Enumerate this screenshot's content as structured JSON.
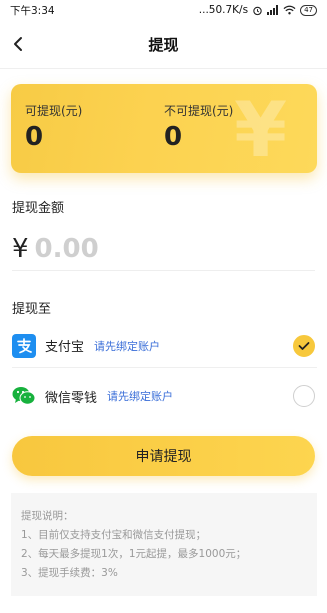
{
  "status_bar": {
    "time": "下午3:34",
    "network_speed": "...50.7K/s",
    "battery": "47"
  },
  "nav": {
    "title": "提现"
  },
  "balance": {
    "withdrawable_label": "可提现(元)",
    "withdrawable_value": "0",
    "non_withdrawable_label": "不可提现(元)",
    "non_withdrawable_value": "0",
    "watermark": "¥"
  },
  "amount": {
    "section_title": "提现金额",
    "currency_symbol": "¥",
    "placeholder": "0.00"
  },
  "methods": {
    "section_title": "提现至",
    "items": [
      {
        "name": "支付宝",
        "bind_text": "请先绑定账户",
        "icon": "alipay-icon",
        "selected": true
      },
      {
        "name": "微信零钱",
        "bind_text": "请先绑定账户",
        "icon": "wechat-icon",
        "selected": false
      }
    ]
  },
  "submit": {
    "label": "申请提现"
  },
  "notes": {
    "lines": [
      "提现说明：",
      "1、目前仅支持支付宝和微信支付提现；",
      "2、每天最多提现1次，1元起提，最多1000元；",
      "3、提现手续费：3%"
    ]
  },
  "colors": {
    "accent": "#fcd250",
    "link": "#3a6ed8",
    "alipay": "#1e8ef0",
    "wechat": "#17b13d"
  }
}
